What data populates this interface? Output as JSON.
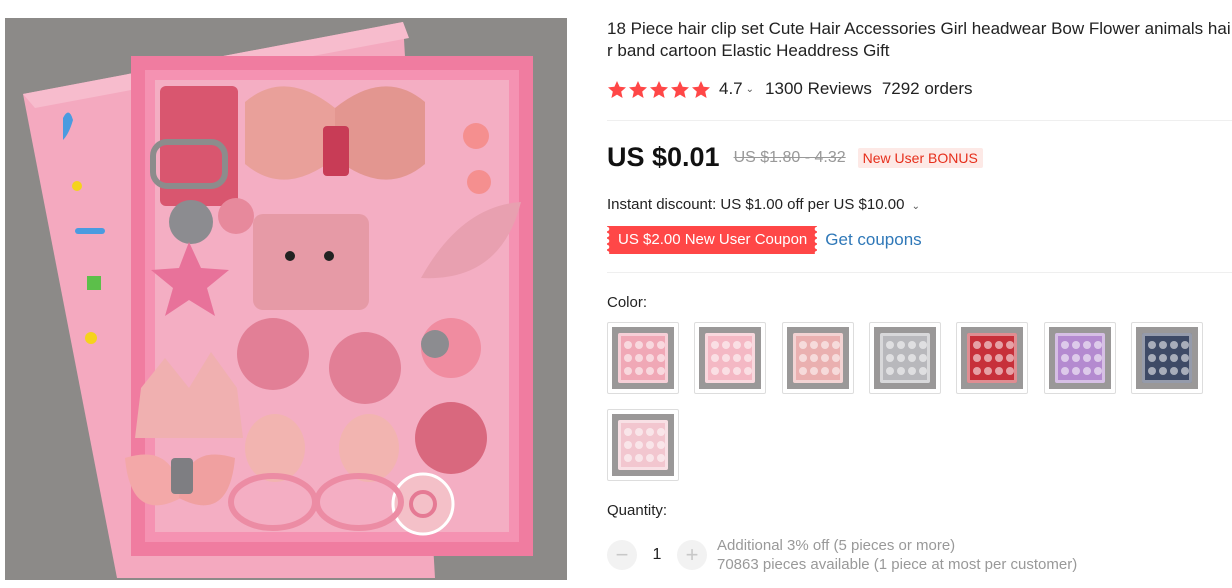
{
  "product": {
    "title": "18 Piece hair clip set Cute Hair Accessories Girl headwear Bow Flower animals hair band cartoon Elastic Headdress Gift",
    "rating": "4.7",
    "reviews": "1300 Reviews",
    "orders": "7292 orders",
    "price": "US $0.01",
    "original_price": "US $1.80 - 4.32",
    "bonus_badge": "New User BONUS",
    "instant_discount": "Instant discount: US $1.00 off per US $10.00",
    "coupon_label": "US $2.00 New User Coupon",
    "get_coupons": "Get coupons",
    "color_label": "Color:",
    "quantity_label": "Quantity:",
    "quantity_value": "1",
    "qty_minus": "−",
    "qty_plus": "+",
    "additional_discount": "Additional 3% off (5 pieces or more)",
    "availability": "70863 pieces available (1 piece at most per customer)",
    "stars_filled": 5
  },
  "icons": {
    "star": "star-icon",
    "chevron": "chevron-down-icon"
  },
  "colors": {
    "star": "#ff4747",
    "coupon_bg": "#ff4747",
    "link": "#2f78b8",
    "bonus_text": "#e62e1b",
    "bonus_bg": "#fde9e6"
  },
  "swatches": [
    {
      "name": "pink-set-1",
      "tone": "#f0a8b6"
    },
    {
      "name": "pink-set-2",
      "tone": "#f4b8c4"
    },
    {
      "name": "pink-set-3",
      "tone": "#eab0b0"
    },
    {
      "name": "grey-set",
      "tone": "#b8b8bc"
    },
    {
      "name": "red-set",
      "tone": "#c7303a"
    },
    {
      "name": "purple-set",
      "tone": "#b48ad0"
    },
    {
      "name": "navy-set",
      "tone": "#3e4a66"
    },
    {
      "name": "gift-box",
      "tone": "#f2c6cf"
    }
  ]
}
